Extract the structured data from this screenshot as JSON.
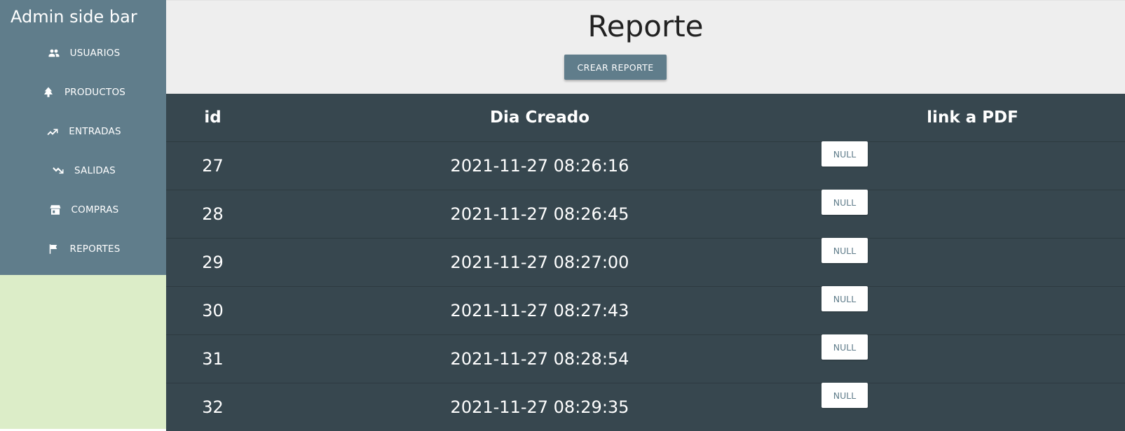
{
  "sidebar": {
    "title": "Admin side bar",
    "items": [
      {
        "label": "USUARIOS",
        "icon": "users-icon"
      },
      {
        "label": "PRODUCTOS",
        "icon": "tree-icon"
      },
      {
        "label": "ENTRADAS",
        "icon": "trending-up-icon"
      },
      {
        "label": "SALIDAS",
        "icon": "trending-down-icon"
      },
      {
        "label": "COMPRAS",
        "icon": "store-icon"
      },
      {
        "label": "REPORTES",
        "icon": "flag-icon"
      }
    ]
  },
  "main": {
    "title": "Reporte",
    "create_button": "CREAR REPORTE",
    "table": {
      "headers": [
        "id",
        "Dia Creado",
        "link a PDF"
      ],
      "rows": [
        {
          "id": "27",
          "date": "2021-11-27 08:26:16",
          "link": "NULL"
        },
        {
          "id": "28",
          "date": "2021-11-27 08:26:45",
          "link": "NULL"
        },
        {
          "id": "29",
          "date": "2021-11-27 08:27:00",
          "link": "NULL"
        },
        {
          "id": "30",
          "date": "2021-11-27 08:27:43",
          "link": "NULL"
        },
        {
          "id": "31",
          "date": "2021-11-27 08:28:54",
          "link": "NULL"
        },
        {
          "id": "32",
          "date": "2021-11-27 08:29:35",
          "link": "NULL"
        }
      ]
    }
  },
  "colors": {
    "sidebar_background": "#607d8b",
    "sidebar_spacer": "#dcedc8",
    "main_background": "#eeeeee",
    "table_background": "#37474f",
    "button_background": "#607d8b",
    "null_button_text": "#607d8b"
  }
}
